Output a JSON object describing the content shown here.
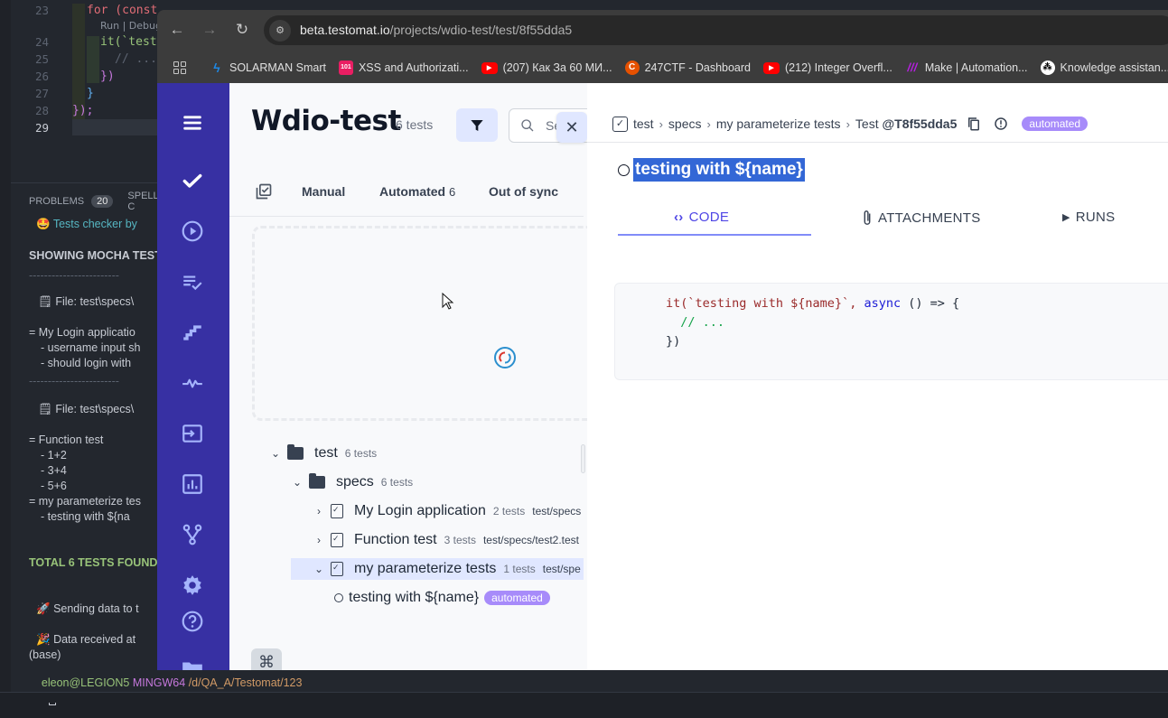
{
  "vscode": {
    "line_numbers": [
      "23",
      "24",
      "25",
      "26",
      "27",
      "28",
      "29"
    ],
    "code_lines": [
      "for (const",
      "it(`test",
      "// ...",
      "})",
      "}",
      "});"
    ],
    "codelens": "Run | Debug",
    "panel": {
      "tab_problems": "PROBLEMS",
      "problems_count": "20",
      "tab_spell": "SPELL C"
    },
    "terminal": {
      "header": "Tests checker by",
      "showing": "SHOWING MOCHA TESTS F",
      "divider": "------------------------",
      "file1": "File: test\\specs\\",
      "suite1": "= My Login applicatio",
      "suite1_items": [
        "- username input sh",
        "- should login with"
      ],
      "file2": "File: test\\specs\\",
      "suite2": "= Function test",
      "suite2_items": [
        "- 1+2",
        "- 3+4",
        "- 5+6"
      ],
      "suite3": "= my parameterize tes",
      "suite3_items": [
        "- testing with ${na"
      ],
      "total": "TOTAL 6 TESTS FOUND",
      "sending": "Sending data to t",
      "received": "Data received at",
      "base": "(base)",
      "prompt_user": "eleon@LEGION5",
      "prompt_host": "MINGW64",
      "prompt_path": "/d/QA_A/Testomat/123",
      "prompt_symbol": "$"
    }
  },
  "browser": {
    "url_host": "beta.testomat.io",
    "url_path": "/projects/wdio-test/test/8f55dda5",
    "bookmarks": [
      {
        "label": "SOLARMAN Smart",
        "icon": "bolt-icon",
        "color": "#1e88e5"
      },
      {
        "label": "XSS and Authorizati...",
        "icon": "h101-icon",
        "color": "#e91e63"
      },
      {
        "label": "(207) Как За 60 МИ...",
        "icon": "youtube-icon",
        "color": "#ff0000"
      },
      {
        "label": "247CTF - Dashboard",
        "icon": "ctf-icon",
        "color": "#e65100"
      },
      {
        "label": "(212) Integer Overfl...",
        "icon": "youtube-icon",
        "color": "#ff0000"
      },
      {
        "label": "Make | Automation...",
        "icon": "make-icon",
        "color": "#9c27b0"
      },
      {
        "label": "Knowledge assistan...",
        "icon": "knowledge-icon",
        "color": "#ffffff"
      }
    ]
  },
  "testomat": {
    "sidebar_icons": [
      "menu-icon",
      "tests-icon",
      "runs-icon",
      "plans-icon",
      "steps-icon",
      "pulse-icon",
      "import-icon",
      "analytics-icon",
      "branches-icon",
      "settings-icon",
      "help-icon",
      "folder-icon"
    ],
    "project": {
      "title": "Wdio-test",
      "count": "6 tests",
      "search_placeholder": "Se"
    },
    "tabs": {
      "manual": "Manual",
      "automated": "Automated",
      "automated_count": "6",
      "out_of_sync": "Out of sync"
    },
    "tree": [
      {
        "name": "test",
        "count": "6 tests"
      },
      {
        "name": "specs",
        "count": "6 tests"
      },
      {
        "name": "My Login application",
        "count": "2 tests",
        "path": "test/specs"
      },
      {
        "name": "Function test",
        "count": "3 tests",
        "path": "test/specs/test2.test"
      },
      {
        "name": "my parameterize tests",
        "count": "1 tests",
        "path": "test/spe"
      },
      {
        "name": "testing with ${name}",
        "badge": "automated"
      }
    ],
    "detail": {
      "breadcrumb": [
        "test",
        "specs",
        "my parameterize tests"
      ],
      "test_label": "Test",
      "test_id": "@T8f55dda5",
      "badge": "automated",
      "title": "testing with ${name}",
      "tabs": [
        "CODE",
        "ATTACHMENTS",
        "RUNS"
      ],
      "code": {
        "line1_fn": "it(`testing with ${name}`,",
        "line1_kw": "async",
        "line1_rest": "() => {",
        "line2": "// ...",
        "line3": "})"
      }
    },
    "colors": {
      "sidebar": "#3730a3",
      "accent": "#4f46e5",
      "badge": "#a78bfa",
      "selection": "#3367d6"
    }
  }
}
